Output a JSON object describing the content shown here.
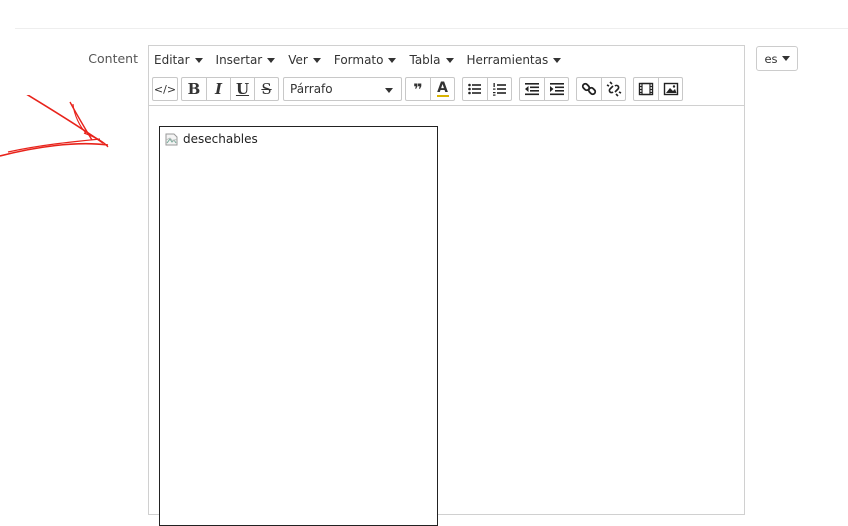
{
  "field": {
    "label": "Content"
  },
  "menubar": {
    "items": [
      {
        "label": "Editar"
      },
      {
        "label": "Insertar"
      },
      {
        "label": "Ver"
      },
      {
        "label": "Formato"
      },
      {
        "label": "Tabla"
      },
      {
        "label": "Herramientas"
      }
    ]
  },
  "toolbar": {
    "code_label": "</>",
    "bold_label": "B",
    "italic_label": "I",
    "underline_label": "U",
    "strike_label": "S",
    "block_format": "Párrafo",
    "blockquote_label": "❞",
    "text_color_label": "A"
  },
  "content": {
    "image_alt": "desechables"
  },
  "language": {
    "selected": "es"
  },
  "annotation": {
    "color": "#e8231b"
  }
}
